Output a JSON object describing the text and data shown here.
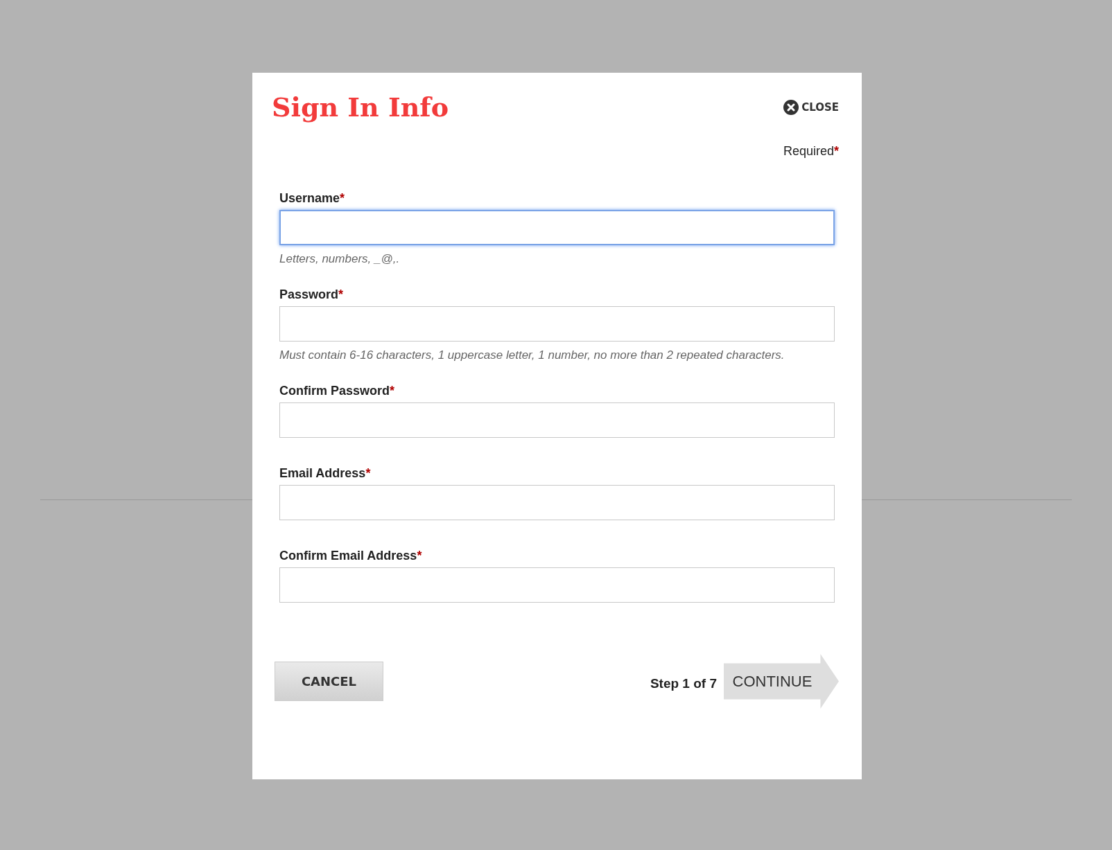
{
  "dialog": {
    "title": "Sign In Info",
    "close": "CLOSE",
    "required_note": {
      "text": "Required",
      "mark": "*"
    }
  },
  "fields": [
    {
      "label": "Username",
      "mark": "*",
      "focused": true,
      "hint": "Letters, numbers, _@,."
    },
    {
      "label": "Password",
      "mark": "*",
      "focused": false,
      "hint": "Must contain 6-16 characters, 1 uppercase letter, 1 number, no more than 2 repeated characters."
    },
    {
      "label": "Confirm Password",
      "mark": "*",
      "focused": false
    },
    {
      "label": "Email Address",
      "mark": "*",
      "focused": false
    },
    {
      "label": "Confirm Email Address",
      "mark": "*",
      "focused": false
    }
  ],
  "footer": {
    "cancel": "CANCEL",
    "step": "Step 1 of 7",
    "continue": "CONTINUE"
  }
}
